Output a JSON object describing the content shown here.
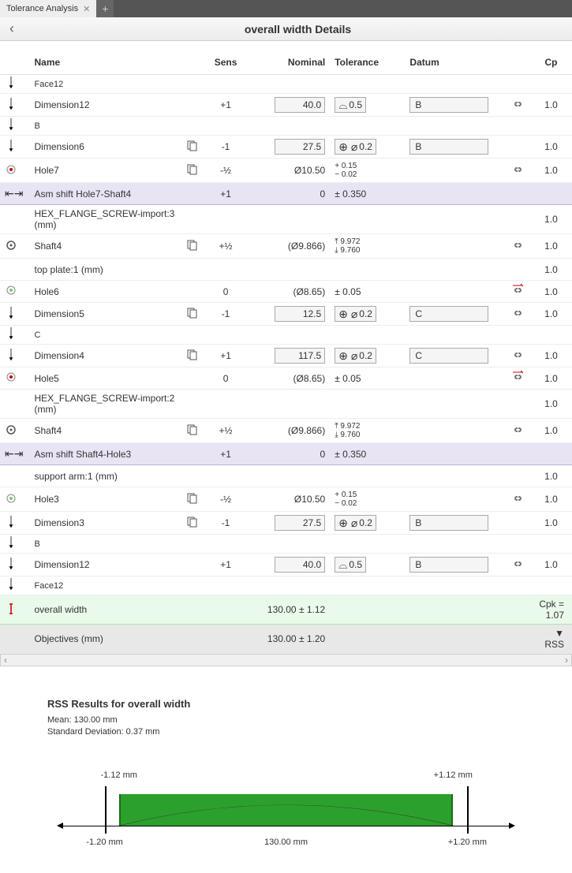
{
  "tab": {
    "name": "Tolerance Analysis",
    "plus": "+"
  },
  "header": {
    "back": "‹",
    "title": "overall width Details"
  },
  "columns": {
    "name": "Name",
    "sens": "Sens",
    "nominal": "Nominal",
    "tolerance": "Tolerance",
    "datum": "Datum",
    "cp": "Cp"
  },
  "rows": [
    {
      "type": "face",
      "name": "Face12"
    },
    {
      "type": "dim",
      "name": "Dimension12",
      "sens": "+1",
      "nominal": "40.0",
      "tol_sym": "⌓",
      "tol": "0.5",
      "datum": "B",
      "link": true,
      "cp": "1.0"
    },
    {
      "type": "label",
      "name": "B"
    },
    {
      "type": "dim",
      "name": "Dimension6",
      "dup": true,
      "sens": "-1",
      "nominal": "27.5",
      "tol_sym": "⊕ ⌀",
      "tol": "0.2",
      "datum": "B",
      "cp": "1.0"
    },
    {
      "type": "hole",
      "name": "Hole7",
      "dup": true,
      "sens": "-½",
      "nominal": "Ø10.50",
      "tol_upper": "0.15",
      "tol_lower": "0.02",
      "link": true,
      "cp": "1.0"
    },
    {
      "type": "asm",
      "name": "Asm shift Hole7-Shaft4",
      "sens": "+1",
      "nominal": "0",
      "pm": "0.350"
    },
    {
      "type": "part",
      "name": "HEX_FLANGE_SCREW-import:3 (mm)",
      "cp": "1.0"
    },
    {
      "type": "shaft",
      "name": "Shaft4",
      "dup": true,
      "sens": "+½",
      "nominal": "(Ø9.866)",
      "meas_upper": "9.972",
      "meas_lower": "9.760",
      "link": true,
      "cp": "1.0"
    },
    {
      "type": "part",
      "name": "top plate:1 (mm)",
      "cp": "1.0"
    },
    {
      "type": "holeo",
      "name": "Hole6",
      "sens": "0",
      "nominal": "(Ø8.65)",
      "pm": "0.05",
      "breaklink": true,
      "cp": "1.0"
    },
    {
      "type": "dim",
      "name": "Dimension5",
      "dup": true,
      "sens": "-1",
      "nominal": "12.5",
      "tol_sym": "⊕ ⌀",
      "tol": "0.2",
      "datum": "C",
      "link": true,
      "cp": "1.0"
    },
    {
      "type": "label",
      "name": "C"
    },
    {
      "type": "dim",
      "name": "Dimension4",
      "dup": true,
      "sens": "+1",
      "nominal": "117.5",
      "tol_sym": "⊕ ⌀",
      "tol": "0.2",
      "datum": "C",
      "link": true,
      "cp": "1.0"
    },
    {
      "type": "hole",
      "name": "Hole5",
      "sens": "0",
      "nominal": "(Ø8.65)",
      "pm": "0.05",
      "breaklink": true,
      "cp": "1.0"
    },
    {
      "type": "part",
      "name": "HEX_FLANGE_SCREW-import:2 (mm)",
      "cp": "1.0"
    },
    {
      "type": "shaft",
      "name": "Shaft4",
      "dup": true,
      "sens": "+½",
      "nominal": "(Ø9.866)",
      "meas_upper": "9.972",
      "meas_lower": "9.760",
      "link": true,
      "cp": "1.0"
    },
    {
      "type": "asm",
      "name": "Asm shift Shaft4-Hole3",
      "sens": "+1",
      "nominal": "0",
      "pm": "0.350"
    },
    {
      "type": "part",
      "name": "support arm:1 (mm)",
      "cp": "1.0"
    },
    {
      "type": "holeo",
      "name": "Hole3",
      "dup": true,
      "sens": "-½",
      "nominal": "Ø10.50",
      "tol_upper": "0.15",
      "tol_lower": "0.02",
      "link": true,
      "cp": "1.0"
    },
    {
      "type": "dim",
      "name": "Dimension3",
      "dup": true,
      "sens": "-1",
      "nominal": "27.5",
      "tol_sym": "⊕ ⌀",
      "tol": "0.2",
      "datum": "B",
      "cp": "1.0"
    },
    {
      "type": "label",
      "name": "B"
    },
    {
      "type": "dim",
      "name": "Dimension12",
      "sens": "+1",
      "nominal": "40.0",
      "tol_sym": "⌓",
      "tol": "0.5",
      "datum": "B",
      "link": true,
      "cp": "1.0"
    },
    {
      "type": "face",
      "name": "Face12"
    }
  ],
  "total": {
    "name": "overall width",
    "nominal": "130.00",
    "pm": "1.12",
    "cpk": "Cpk = 1.07"
  },
  "objectives": {
    "name": "Objectives (mm)",
    "nominal": "130.00",
    "pm": "1.20",
    "method": "▼ RSS"
  },
  "results": {
    "title": "RSS Results for overall width",
    "mean": "Mean: 130.00 mm",
    "stddev": "Standard Deviation: 0.37 mm"
  },
  "chart_data": {
    "type": "bar",
    "center": "130.00 mm",
    "inner_low": "-1.12 mm",
    "inner_high": "+1.12 mm",
    "outer_low": "-1.20 mm",
    "outer_high": "+1.20 mm",
    "inner_low_pct": 15,
    "inner_high_pct": 85,
    "outer_low_pct": 12,
    "outer_high_pct": 88
  }
}
